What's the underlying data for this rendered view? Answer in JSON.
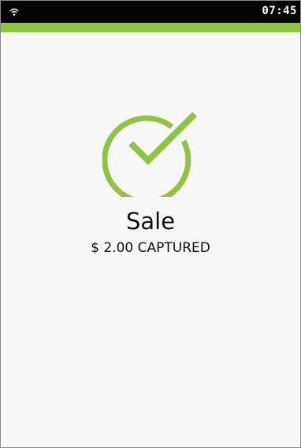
{
  "status_bar": {
    "time": "07:45",
    "signal_icon": "wifi-icon"
  },
  "colors": {
    "accent": "#8cc63f",
    "status_bar": "#050505"
  },
  "result": {
    "icon": "check-circle-icon",
    "title": "Sale",
    "message": "$ 2.00 CAPTURED"
  }
}
